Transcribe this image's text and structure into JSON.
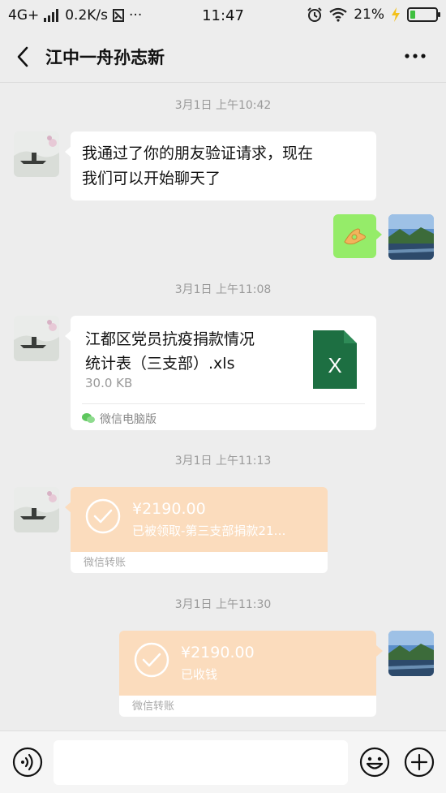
{
  "status_bar": {
    "network": "4G+",
    "speed": "0.2K/s",
    "overflow": "···",
    "time": "11:47",
    "battery_text": "21%",
    "battery_level": 0.21,
    "battery_color": "#3fbf3f"
  },
  "header": {
    "title": "江中一舟孙志新",
    "back_icon": "chevron-left-icon",
    "more_icon": "more-dots-icon"
  },
  "messages": [
    {
      "type": "timestamp",
      "text": "3月1日 上午10:42"
    },
    {
      "type": "text",
      "side": "left",
      "lines": [
        "我通过了你的朋友验证请求，现在",
        "我们可以开始聊天了"
      ]
    },
    {
      "type": "emoji",
      "side": "right",
      "emoji": "👌",
      "bubble_color": "#95ec69"
    },
    {
      "type": "timestamp",
      "text": "3月1日 上午11:08"
    },
    {
      "type": "file",
      "side": "left",
      "name_lines": [
        "江都区党员抗疫捐款情况",
        "统计表（三支部）.xls"
      ],
      "size": "30.0 KB",
      "source": "微信电脑版",
      "file_icon": "excel-file-icon",
      "file_icon_color": "#1d6f42",
      "file_icon_letter": "X"
    },
    {
      "type": "timestamp",
      "text": "3月1日 上午11:13"
    },
    {
      "type": "transfer",
      "side": "left",
      "amount": "¥2190.00",
      "desc": "已被领取-第三支部捐款21…",
      "label": "微信转账",
      "color": "#fbdcbd"
    },
    {
      "type": "timestamp",
      "text": "3月1日 上午11:30"
    },
    {
      "type": "transfer",
      "side": "right",
      "amount": "¥2190.00",
      "desc": "已收钱",
      "label": "微信转账",
      "color": "#fbdcbd"
    }
  ],
  "input_bar": {
    "voice_icon": "voice-icon",
    "emoji_icon": "emoji-face-icon",
    "plus_icon": "plus-circle-icon",
    "text_value": ""
  }
}
